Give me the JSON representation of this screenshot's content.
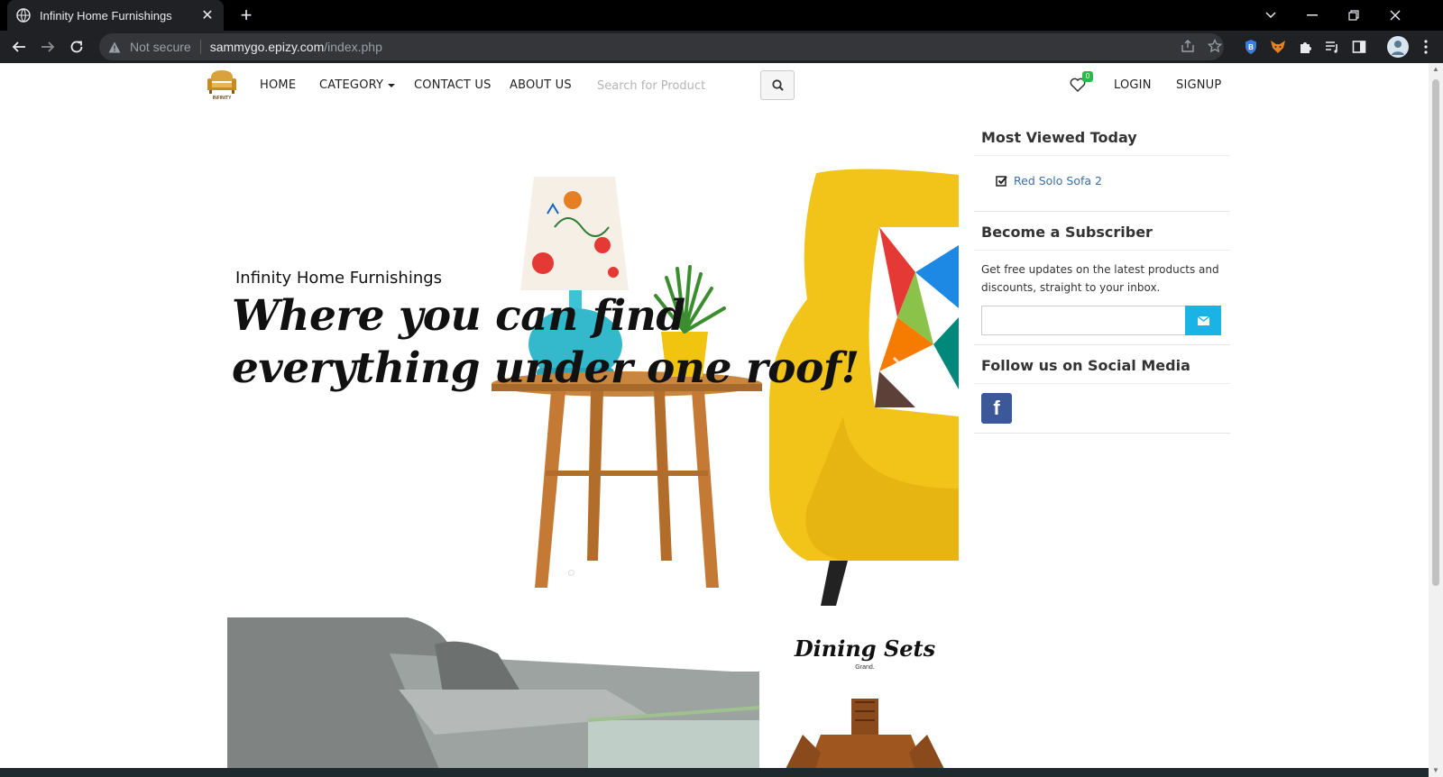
{
  "browser": {
    "tab_title": "Infinity Home Furnishings",
    "new_tab_symbol": "+",
    "not_secure_label": "Not secure",
    "url_host": "sammygo.epizy.com",
    "url_path": "/index.php"
  },
  "nav": {
    "logo_text": "INFINITY",
    "home": "HOME",
    "category": "CATEGORY",
    "contact": "CONTACT US",
    "about": "ABOUT US",
    "search_placeholder": "Search for Product",
    "wishlist_count": "0",
    "login": "LOGIN",
    "signup": "SIGNUP"
  },
  "hero": {
    "subtitle": "Infinity Home Furnishings",
    "title_line1": "Where you can find",
    "title_line2": "everything under one roof!"
  },
  "banners": {
    "dining_title": "Dining Sets",
    "dining_sub": "Grand."
  },
  "sidebar": {
    "most_viewed_title": "Most Viewed Today",
    "most_viewed_items": [
      "Red Solo Sofa 2"
    ],
    "subscriber_title": "Become a Subscriber",
    "subscriber_text": "Get free updates on the latest products and discounts, straight to your inbox.",
    "social_title": "Follow us on Social Media",
    "facebook_letter": "f"
  },
  "colors": {
    "accent_blue": "#1ab3e6",
    "link_blue": "#3a6ea5",
    "facebook": "#3b5998",
    "badge_green": "#2db84b",
    "chair_yellow": "#f2c318"
  }
}
